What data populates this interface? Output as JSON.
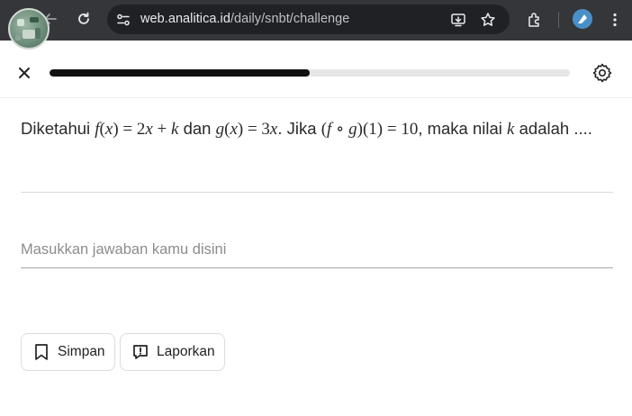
{
  "browser": {
    "url_host": "web.analitica.id",
    "url_path": "/daily/snbt/challenge",
    "icons": [
      "back-icon",
      "reload-icon",
      "site-info-icon",
      "install-app-icon",
      "bookmark-star-icon",
      "extensions-icon",
      "profile-icon",
      "menu-icon"
    ]
  },
  "header": {
    "progress": 0.5,
    "icons": [
      "close-icon",
      "settings-gear-icon"
    ]
  },
  "question": {
    "text_1": "Diketahui ",
    "math_f": "f(x) = 2x + k",
    "text_2": " dan ",
    "math_g": "g(x) = 3x",
    "text_3": ". Jika ",
    "math_comp": "(f ∘ g)(1) = 10",
    "text_4": ", maka nilai ",
    "math_k": "k",
    "text_5": " adalah ...."
  },
  "answer": {
    "placeholder": "Masukkan jawaban kamu disini",
    "value": ""
  },
  "actions": {
    "save_label": "Simpan",
    "report_label": "Laporkan"
  },
  "colors": {
    "chrome_bg": "#35363a",
    "omnibox_bg": "#202124",
    "progress_fill": "#111111",
    "progress_track": "#e6e6e6"
  }
}
